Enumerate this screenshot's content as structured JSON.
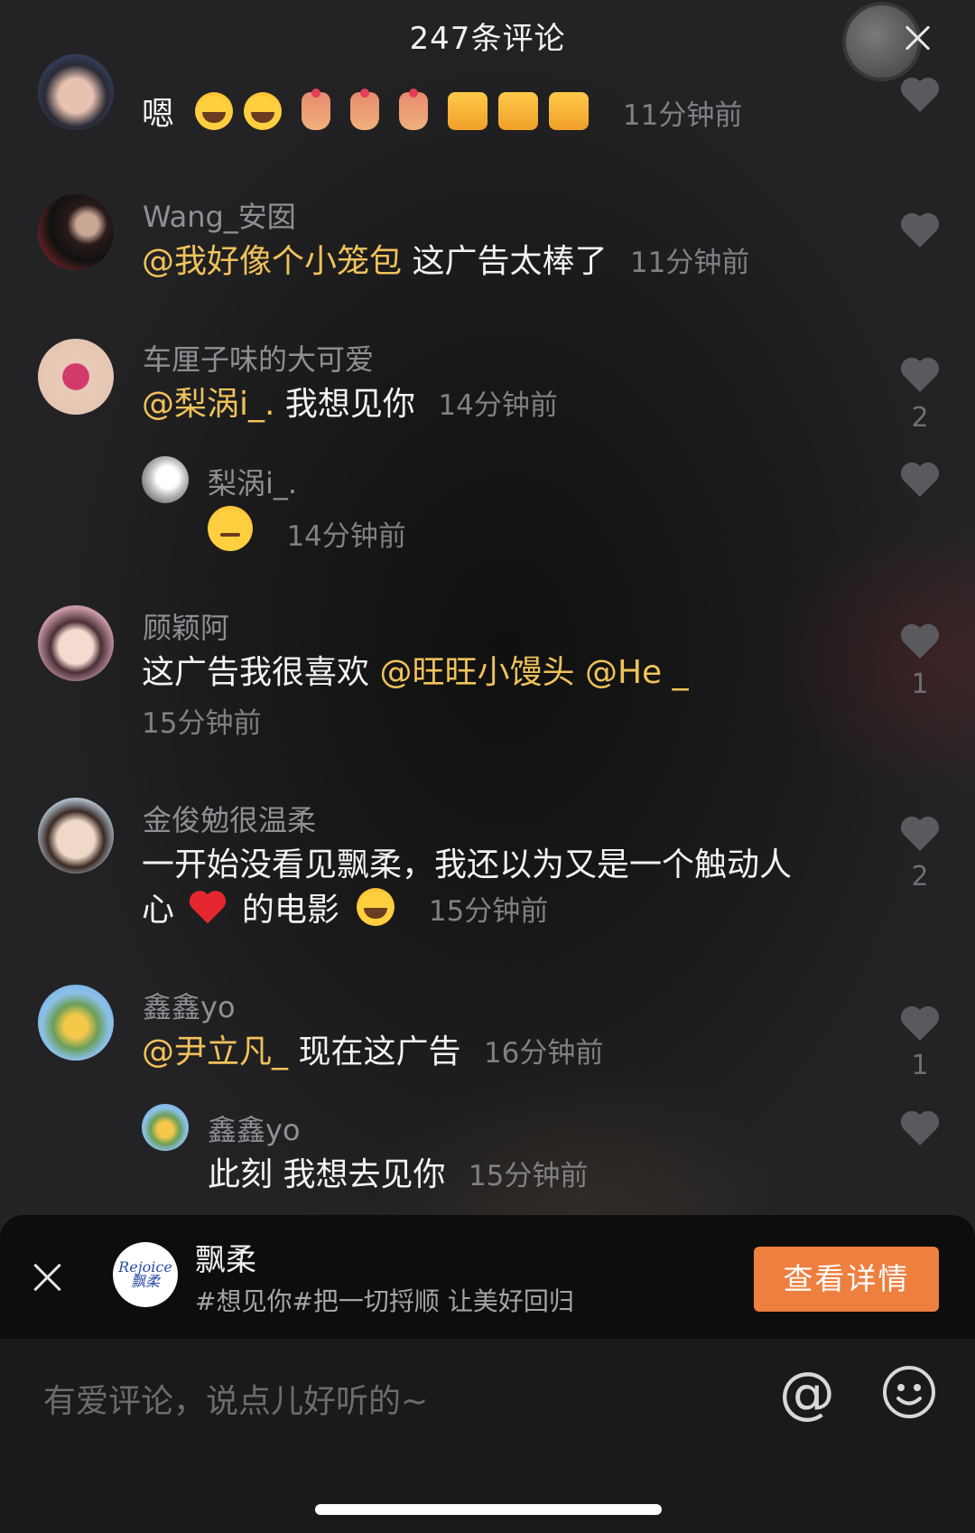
{
  "header": {
    "title": "247条评论"
  },
  "comments": [
    {
      "name": "",
      "text": "嗯",
      "emojis": [
        "face-with-tears-of-joy",
        "face-with-tears-of-joy",
        "hand-with-heart",
        "hand-with-heart",
        "hand-with-heart",
        "thumbs-up",
        "thumbs-up",
        "thumbs-up"
      ],
      "time": "11分钟前",
      "likes": ""
    },
    {
      "name": "Wang_安囡",
      "mention": "@我好像个小笼包",
      "text": "这广告太棒了",
      "time": "11分钟前",
      "likes": ""
    },
    {
      "name": "车厘子味的大可爱",
      "mention": "@梨涡i_.",
      "text": "我想见你",
      "time": "14分钟前",
      "likes": "2",
      "reply": {
        "name": "梨涡i_.",
        "emoji": "smirking-face",
        "time": "14分钟前",
        "likes": ""
      }
    },
    {
      "name": "顾颖阿",
      "text": "这广告我很喜欢",
      "mention1": "@旺旺小馒头",
      "mention2": "@He _",
      "time": "15分钟前",
      "likes": "1"
    },
    {
      "name": "金俊勉很温柔",
      "line1": "一开始没看见飘柔，我还以为又是一个触动人",
      "line2a": "心",
      "line2b": "的电影",
      "emojis": [
        "red-heart",
        "face-with-tears-of-joy"
      ],
      "time": "15分钟前",
      "likes": "2"
    },
    {
      "name": "鑫鑫yo",
      "mention": "@尹立凡_",
      "text": "现在这广告",
      "time": "16分钟前",
      "likes": "1",
      "reply": {
        "name": "鑫鑫yo",
        "text": "此刻 我想去见你",
        "time": "15分钟前",
        "likes": ""
      }
    }
  ],
  "ad": {
    "brand": "飘柔",
    "logo_text": "Rejoice 飘柔",
    "description": "#想见你#把一切捋顺 让美好回归",
    "button": "查看详情"
  },
  "input": {
    "placeholder": "有爱评论，说点儿好听的~",
    "at_symbol": "@"
  },
  "colors": {
    "mention": "#f0c25a",
    "accent": "#ed7f3f",
    "background": "#232325"
  }
}
